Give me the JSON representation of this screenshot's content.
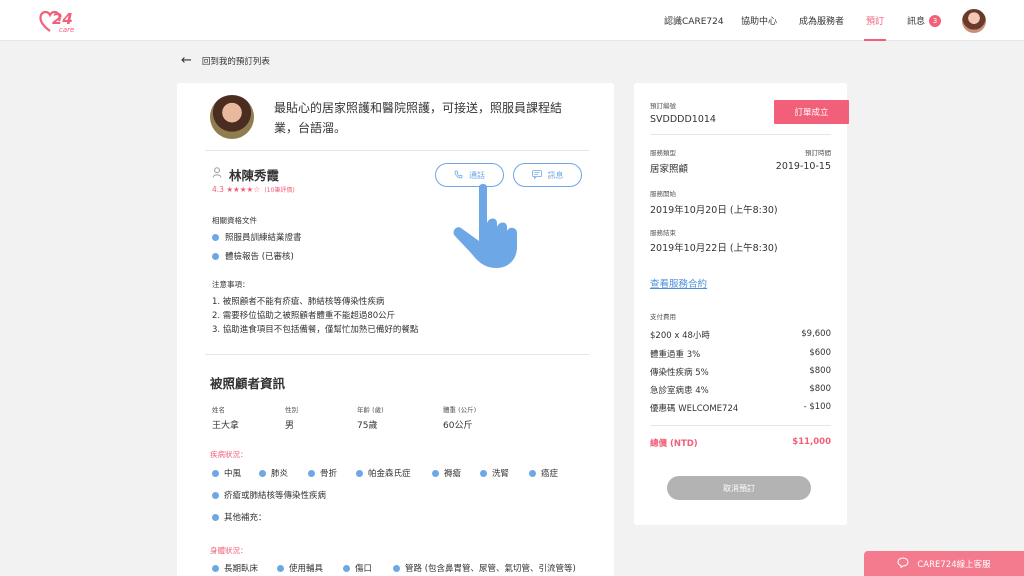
{
  "brand": {
    "logo_text": "24",
    "logo_sub": "care"
  },
  "nav": {
    "items": [
      "認識CARE724",
      "協助中心",
      "成為服務者",
      "預訂",
      "訊息"
    ],
    "message_count": "3"
  },
  "back_link": "回到我的預訂列表",
  "caregiver": {
    "headline": "最貼心的居家照護和醫院照護，可接送，照服員課程結業，台語溜。",
    "name": "林陳秀霞",
    "rating": "4.3",
    "stars": "★★★★☆",
    "reviews": "(10筆評價)",
    "call_label": "通話",
    "message_label": "訊息",
    "qualifications_title": "相關資格文件",
    "qualifications": [
      "照服員訓練結業證書",
      "體檢報告 (已審核)"
    ],
    "notes_title": "注意事項：",
    "notes": [
      "1.  被照顧者不能有疥瘡、肺結核等傳染性疾病",
      "2.  需要移位協助之被照顧者體重不能超過80公斤",
      "3.  協助進食項目不包括備餐，僅幫忙加熱已備好的餐點"
    ]
  },
  "patient": {
    "title": "被照顧者資訊",
    "fields": [
      {
        "label": "姓名",
        "value": "王大拿"
      },
      {
        "label": "性別",
        "value": "男"
      },
      {
        "label": "年齡 (歲)",
        "value": "75歲"
      },
      {
        "label": "體重 (公斤)",
        "value": "60公斤"
      }
    ],
    "disease_label": "疾病狀況：",
    "diseases": [
      "中風",
      "肺炎",
      "骨折",
      "帕金森氏症",
      "褥瘡",
      "洗腎",
      "癌症"
    ],
    "disease_extra": "疥瘡或肺結核等傳染性疾病",
    "disease_other": "其他補充：",
    "body_label": "身體狀況：",
    "body_items": [
      "長期臥床",
      "使用輔具",
      "傷口",
      "管路 (包含鼻胃管、尿管、氣切管、引流管等)"
    ]
  },
  "order": {
    "id_label": "預訂編號",
    "id": "SVDDDD1014",
    "status": "訂單成立",
    "type_label": "服務類型",
    "type": "居家照顧",
    "date_label": "預訂時間",
    "date": "2019-10-15",
    "start_label": "服務開始",
    "start": "2019年10月20日 (上午8:30)",
    "end_label": "服務結束",
    "end": "2019年10月22日 (上午8:30)",
    "contract_link": "查看服務合約",
    "fee_label": "支付費用",
    "fees": [
      {
        "name": "$200 x 48小時",
        "amount": "$9,600"
      },
      {
        "name": "體重過重 3%",
        "amount": "$600"
      },
      {
        "name": "傳染性疾病 5%",
        "amount": "$800"
      },
      {
        "name": "急診室病患 4%",
        "amount": "$800"
      },
      {
        "name": "優惠碼 WELCOME724",
        "amount": "- $100"
      }
    ],
    "total_label": "總價 (NTD)",
    "total": "$11,000",
    "cancel_label": "取消預訂"
  },
  "support_label": "CARE724線上客服",
  "colors": {
    "accent": "#f25f79",
    "link": "#6da7e5"
  }
}
